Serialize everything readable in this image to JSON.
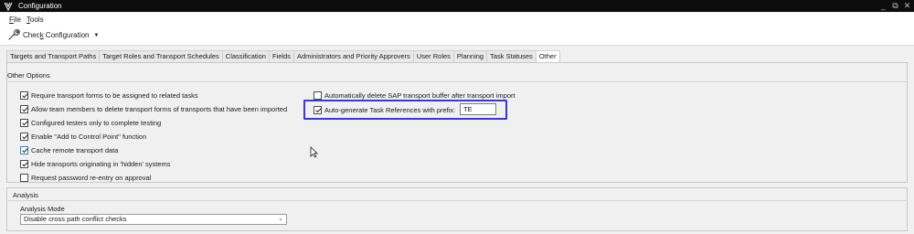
{
  "window": {
    "title": "Configuration",
    "controls": [
      "_",
      "⧉",
      "✕"
    ]
  },
  "menu": {
    "items": [
      {
        "label": "File",
        "key": "F",
        "rest": "ile"
      },
      {
        "label": "Tools",
        "key": "T",
        "rest": "ools"
      }
    ]
  },
  "toolbar": {
    "check_label": "Check Configuration",
    "check_prefix": "Chec",
    "check_key": "k",
    "check_rest": " Configuration"
  },
  "tabs": [
    "Targets and Transport Paths",
    "Target Roles and Transport Schedules",
    "Classification",
    "Fields",
    "Administrators and Priority Approvers",
    "User Roles",
    "Planning",
    "Task Statuses",
    "Other"
  ],
  "active_tab": "Other",
  "other_options": {
    "title": "Other Options",
    "left": [
      {
        "label": "Require transport forms to be assigned to related tasks",
        "checked": true
      },
      {
        "label": "Allow team members to delete transport forms of transports that have been imported",
        "checked": true
      },
      {
        "label": "Configured testers only to complete testing",
        "checked": true
      },
      {
        "label": "Enable \"Add to Control Point\" function",
        "checked": true
      },
      {
        "label": "Cache remote transport data",
        "checked": true
      },
      {
        "label": "Hide transports originating in 'hidden' systems",
        "checked": true
      },
      {
        "label": "Request password re-entry on approval",
        "checked": false
      }
    ],
    "right": [
      {
        "label": "Automatically delete SAP transport buffer after transport import",
        "checked": false
      },
      {
        "label": "Auto-generate Task References with prefix:",
        "checked": true
      }
    ],
    "prefix_value": "TE"
  },
  "analysis": {
    "title": "Analysis",
    "mode_label": "Analysis Mode",
    "mode_value": "Disable cross path conflict checks"
  },
  "colors": {
    "highlight": "#3a3ad0",
    "titlebar": "#0c0c0c"
  }
}
